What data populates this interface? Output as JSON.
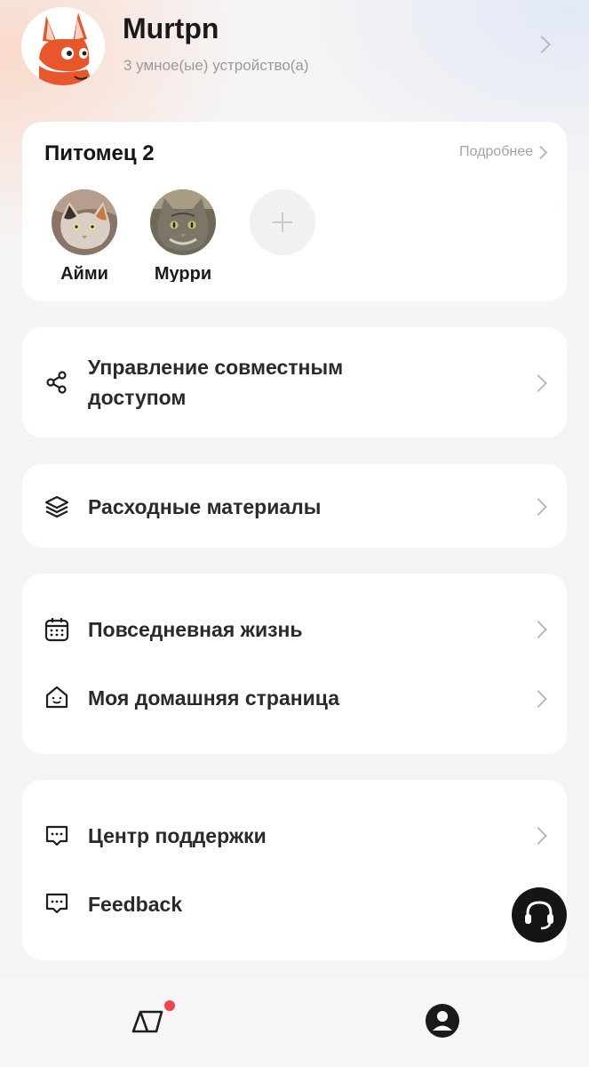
{
  "profile": {
    "username": "Murtpn",
    "device_count": "3 умное(ые) устройство(а)",
    "avatar_icon": "fox-avatar-icon"
  },
  "pets": {
    "title": "Питомец 2",
    "more_link": "Подробнее",
    "items": [
      {
        "name": "Айми",
        "icon": "cat-photo-tabby"
      },
      {
        "name": "Мурри",
        "icon": "cat-photo-gray"
      }
    ],
    "add_icon": "plus-icon"
  },
  "menu": {
    "sharing": {
      "label_line1": "Управление совместным",
      "label_line2": "доступом",
      "icon": "share-icon"
    },
    "consumables": {
      "label": "Расходные материалы",
      "icon": "layers-icon"
    },
    "daily_life": {
      "label": "Повседневная жизнь",
      "icon": "calendar-icon"
    },
    "my_home": {
      "label": "Моя домашняя страница",
      "icon": "home-smile-icon"
    },
    "support": {
      "label": "Центр поддержки",
      "icon": "chat-icon"
    },
    "feedback": {
      "label": "Feedback",
      "icon": "chat-icon"
    }
  },
  "fab": {
    "icon": "headset-icon"
  },
  "tabbar": {
    "items": [
      {
        "icon": "devices-icon",
        "has_notification": true
      },
      {
        "icon": "profile-icon",
        "active": true
      }
    ]
  },
  "colors": {
    "background": "#f4f4f6",
    "card": "#ffffff",
    "notification_dot": "#f0454b",
    "fab": "#151515"
  }
}
